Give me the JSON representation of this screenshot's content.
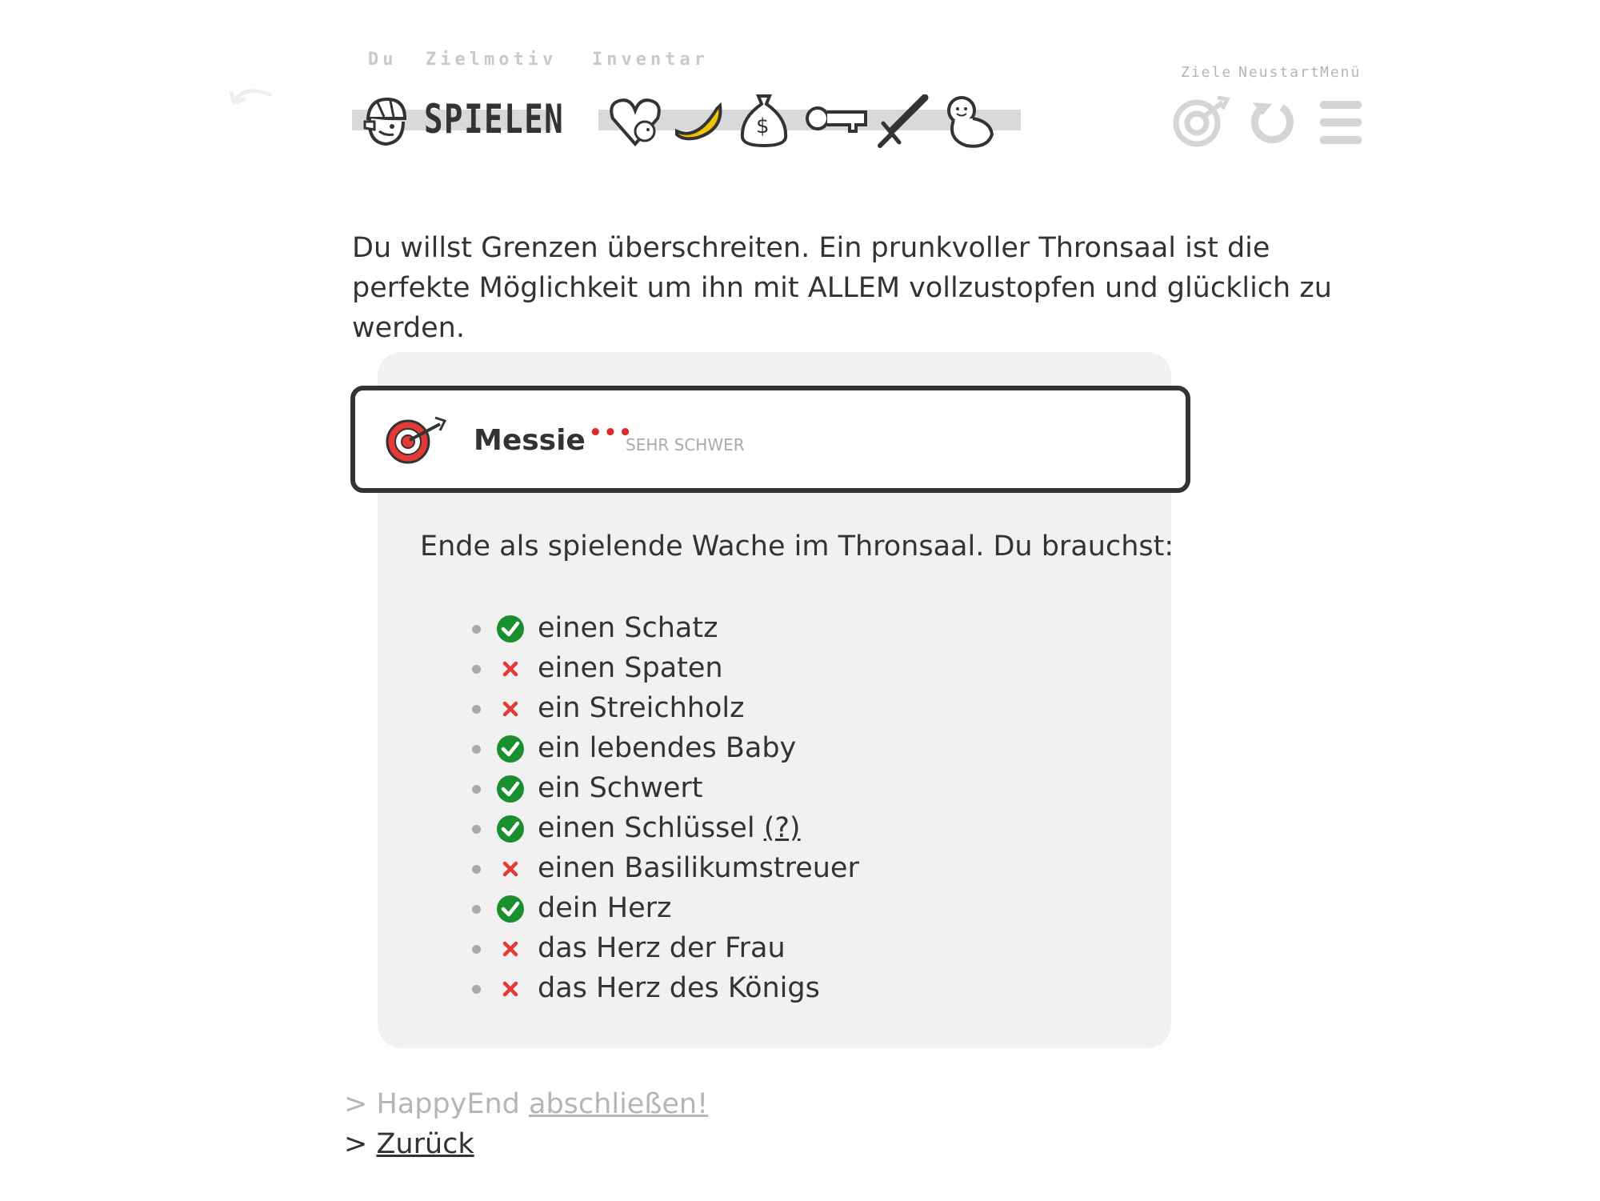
{
  "header": {
    "labels": {
      "du": "Du",
      "zielmotiv": "Zielmotiv",
      "inventar": "Inventar"
    },
    "play_label": "SPIELEN",
    "inventory_icons": [
      "heart-with-face-icon",
      "banana-icon",
      "money-bag-icon",
      "key-icon",
      "sword-icon",
      "baby-icon"
    ],
    "nav": {
      "ziele": "Ziele",
      "neustart": "Neustart",
      "menu": "Menü"
    }
  },
  "intro": "Du willst Grenzen überschreiten. Ein prunkvoller Thronsaal ist die perfekte Möglichkeit um ihn mit ALLEM vollzustopfen und glücklich zu werden.",
  "goal": {
    "title": "Messie",
    "dots": "•••",
    "difficulty": "SEHR SCHWER",
    "description": "Ende als spielende Wache im Thronsaal. Du brauchst:",
    "requirements": [
      {
        "text": "einen Schatz",
        "done": true
      },
      {
        "text": "einen Spaten",
        "done": false
      },
      {
        "text": "ein Streichholz",
        "done": false
      },
      {
        "text": "ein lebendes Baby",
        "done": true
      },
      {
        "text": "ein Schwert",
        "done": true
      },
      {
        "text": "einen Schlüssel",
        "done": true,
        "hint": "(?)"
      },
      {
        "text": "einen Basilikumstreuer",
        "done": false
      },
      {
        "text": "dein Herz",
        "done": true
      },
      {
        "text": "das Herz der Frau",
        "done": false
      },
      {
        "text": "das Herz des Königs",
        "done": false
      }
    ]
  },
  "actions": {
    "happyend_prefix": "> HappyEnd ",
    "happyend_link": "abschließen!",
    "back_prefix": "> ",
    "back_link": "Zurück"
  },
  "colors": {
    "check": "#1a8f2e",
    "cross": "#e53935",
    "dots": "#e02b2b",
    "muted": "#b5b5b5"
  }
}
